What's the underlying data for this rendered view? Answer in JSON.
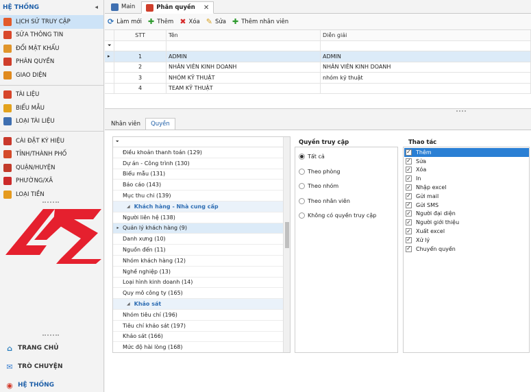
{
  "sidebar": {
    "title": "HỆ THỐNG",
    "collapse_icon": "◂",
    "items": [
      {
        "label": "LỊCH SỬ TRUY CẬP",
        "color": "#e25a2b",
        "active": true
      },
      {
        "label": "SỬA THÔNG TIN",
        "color": "#d9482b"
      },
      {
        "label": "ĐỔI MẬT KHẨU",
        "color": "#e0952b"
      },
      {
        "label": "PHÂN QUYỀN",
        "color": "#cf3e2b"
      },
      {
        "label": "GIAO DIỆN",
        "color": "#e08a1e"
      },
      {
        "label": "TÀI LIỆU",
        "color": "#d6452a"
      },
      {
        "label": "BIỂU MẪU",
        "color": "#e3a21d"
      },
      {
        "label": "LOẠI TÀI LIỆU",
        "color": "#3f6fb0"
      },
      {
        "label": "CÀI ĐẶT KÝ HIỆU",
        "color": "#c9382b"
      },
      {
        "label": "TỈNH/THÀNH PHỐ",
        "color": "#d44a2a"
      },
      {
        "label": "QUẬN/HUYỆN",
        "color": "#c23b2a"
      },
      {
        "label": "PHƯỜNG/XÃ",
        "color": "#cc2b2b"
      },
      {
        "label": "LOẠI TIỀN",
        "color": "#e59a1e"
      }
    ],
    "bottom_nav": [
      {
        "label": "TRANG CHỦ",
        "icon": "home-icon"
      },
      {
        "label": "TRÒ CHUYỆN",
        "icon": "chat-icon"
      },
      {
        "label": "HỆ THỐNG",
        "icon": "system-icon",
        "active": true
      }
    ]
  },
  "tabs": [
    {
      "label": "Main",
      "active": false
    },
    {
      "label": "Phân quyền",
      "active": true
    }
  ],
  "toolbar": {
    "refresh": "Làm mới",
    "add": "Thêm",
    "delete": "Xóa",
    "edit": "Sửa",
    "add_employee": "Thêm nhân viên"
  },
  "grid": {
    "columns": [
      "STT",
      "Tên",
      "Diễn giải"
    ],
    "rows": [
      {
        "stt": "1",
        "ten": "ADMIN",
        "dien_giai": "ADMIN"
      },
      {
        "stt": "2",
        "ten": "NHÂN VIÊN KINH DOANH",
        "dien_giai": "NHÂN VIÊN KINH DOANH"
      },
      {
        "stt": "3",
        "ten": "NHÓM KỸ THUẬT",
        "dien_giai": "nhóm kỹ thuật"
      },
      {
        "stt": "4",
        "ten": "TEAM KỸ THUẬT",
        "dien_giai": ""
      }
    ]
  },
  "lower_tabs": [
    "Nhân viên",
    "Quyền"
  ],
  "tree": {
    "rows": [
      {
        "text": "Điều khoản thanh toán (129)"
      },
      {
        "text": "Dự án - Công trình (130)"
      },
      {
        "text": "Biểu mẫu (131)"
      },
      {
        "text": "Báo cáo (143)"
      },
      {
        "text": "Mục thu chi (139)"
      },
      {
        "text": "Khách hàng - Nhà cung cấp",
        "group": true
      },
      {
        "text": "Người liên hệ (138)"
      },
      {
        "text": "Quản lý khách hàng (9)",
        "selected": true
      },
      {
        "text": "Danh xưng (10)"
      },
      {
        "text": "Nguồn đến (11)"
      },
      {
        "text": "Nhóm khách hàng (12)"
      },
      {
        "text": "Nghề nghiệp (13)"
      },
      {
        "text": "Loại hình kinh doanh (14)"
      },
      {
        "text": "Quy mô công ty (165)"
      },
      {
        "text": "Khảo sát",
        "group": true
      },
      {
        "text": "Nhóm tiêu chí (196)"
      },
      {
        "text": "Tiêu chí khảo sát (197)"
      },
      {
        "text": "Khảo sát (166)"
      },
      {
        "text": "Mức độ hài lòng (168)"
      }
    ]
  },
  "access": {
    "title": "Quyền truy cập",
    "options": [
      "Tất cả",
      "Theo phòng",
      "Theo nhóm",
      "Theo nhân viên",
      "Không có quyền truy cập"
    ],
    "selected_index": 0
  },
  "actions": {
    "title": "Thao tác",
    "items": [
      "Thêm",
      "Sửa",
      "Xóa",
      "In",
      "Nhập excel",
      "Gửi mail",
      "Gửi SMS",
      "Người đại diện",
      "Người giới thiệu",
      "Xuất excel",
      "Xử lý",
      "Chuyển quyền"
    ],
    "highlight_index": 0
  }
}
